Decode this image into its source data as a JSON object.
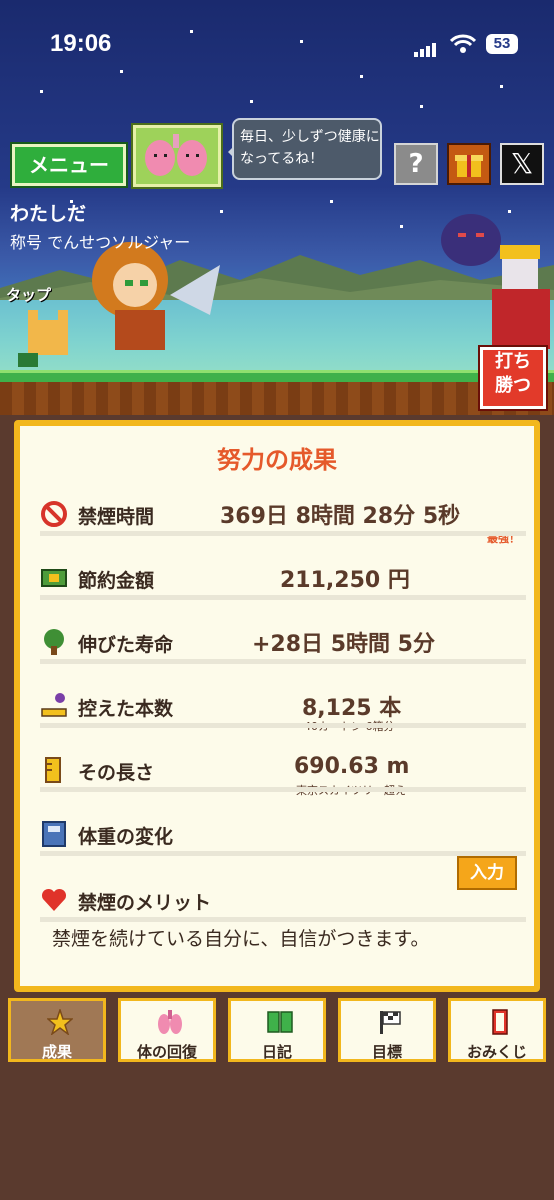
{
  "status_bar": {
    "time": "19:06",
    "battery": "53"
  },
  "header": {
    "menu_label": "メニュー",
    "speech": "毎日、少しずつ健康になってるね！",
    "help_label": "?",
    "x_label": "𝕏"
  },
  "player": {
    "name": "わたしだ",
    "title": "称号 でんせつソルジャー",
    "tap_label": "タップ",
    "fight_label_1": "打ち",
    "fight_label_2": "勝つ"
  },
  "panel": {
    "heading": "努力の成果",
    "rows": [
      {
        "label": "禁煙時間",
        "value": "369日  8時間  28分  5秒",
        "note": "最強！"
      },
      {
        "label": "節約金額",
        "value": "211,250 円"
      },
      {
        "label": "伸びた寿命",
        "value": "+28日  5時間  5分"
      },
      {
        "label": "控えた本数",
        "value": "8,125 本",
        "sub": "40カートン 6箱分"
      },
      {
        "label": "その長さ",
        "value": "690.63 m",
        "sub": "東京スカイツリー超え"
      },
      {
        "label": "体重の変化"
      },
      {
        "label": "禁煙のメリット"
      }
    ],
    "input_label": "入力",
    "merit_text": "禁煙を続けている自分に、自信がつきます。"
  },
  "tabs": [
    {
      "label": "成果",
      "icon": "star-icon",
      "active": true
    },
    {
      "label": "体の回復",
      "icon": "lungs-icon"
    },
    {
      "label": "日記",
      "icon": "book-icon"
    },
    {
      "label": "目標",
      "icon": "flag-icon"
    },
    {
      "label": "おみくじ",
      "icon": "omikuji-icon"
    }
  ],
  "colors": {
    "accent": "#e5592b",
    "panel_border": "#f2b71d",
    "menu_green": "#2fae3c",
    "background": "#5a3a2e"
  }
}
